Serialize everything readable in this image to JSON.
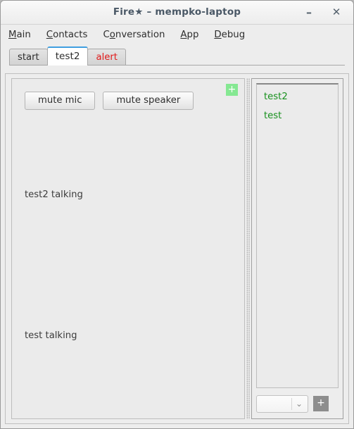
{
  "window": {
    "title": "Fire★ – mempko-laptop",
    "minimize_label": "–",
    "close_label": "✕"
  },
  "menubar": {
    "items": [
      {
        "pre": "",
        "mn": "M",
        "post": "ain"
      },
      {
        "pre": "",
        "mn": "C",
        "post": "ontacts"
      },
      {
        "pre": "C",
        "mn": "o",
        "post": "nversation"
      },
      {
        "pre": "",
        "mn": "A",
        "post": "pp"
      },
      {
        "pre": "",
        "mn": "D",
        "post": "ebug"
      }
    ]
  },
  "tabs": [
    {
      "label": "start"
    },
    {
      "label": "test2"
    },
    {
      "label": "alert"
    }
  ],
  "conversation": {
    "mute_mic_label": "mute mic",
    "mute_speaker_label": "mute speaker",
    "add_label": "+",
    "messages": [
      "test2 talking",
      "test talking"
    ]
  },
  "contacts": {
    "items": [
      {
        "name": "test2"
      },
      {
        "name": "test"
      }
    ],
    "selector_value": "",
    "selector_arrow": "⌄",
    "add_label": "+"
  },
  "colors": {
    "accent_tab": "#3f9fe0",
    "alert": "#e21b1b",
    "contact_green": "#17901d",
    "add_green": "#85e892",
    "title_text": "#4a5866"
  }
}
